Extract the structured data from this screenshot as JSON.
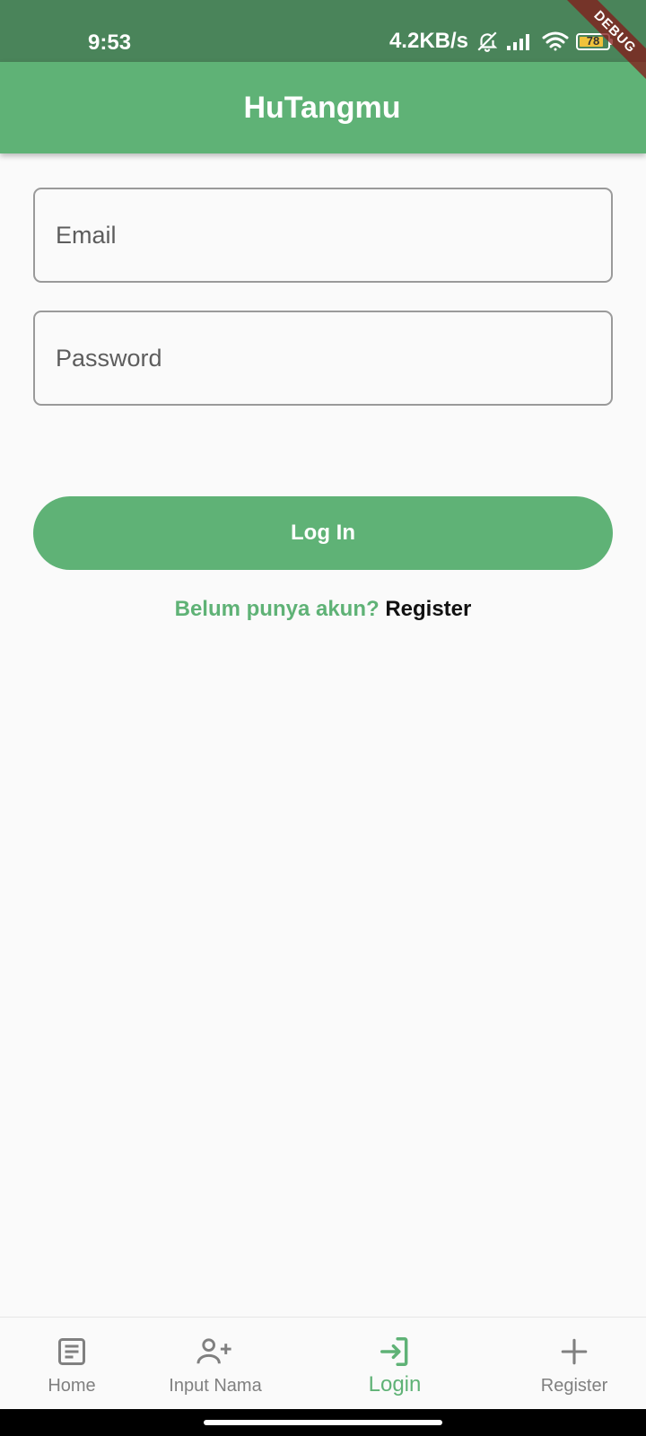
{
  "status_bar": {
    "time": "9:53",
    "network_speed": "4.2KB/s",
    "battery_level": "78",
    "icons": [
      "mute-bell-icon",
      "signal-icon",
      "wifi-icon",
      "battery-icon"
    ]
  },
  "debug_banner": "DEBUG",
  "app_bar": {
    "title": "HuTangmu"
  },
  "form": {
    "email_placeholder": "Email",
    "password_placeholder": "Password",
    "login_label": "Log In",
    "register_prompt": "Belum punya akun?",
    "register_link": "Register"
  },
  "bottom_nav": {
    "active": "Login",
    "items": [
      {
        "label": "Home",
        "icon": "article-icon"
      },
      {
        "label": "Input Nama",
        "icon": "person-add-icon"
      },
      {
        "label": "Login",
        "icon": "login-icon"
      },
      {
        "label": "Register",
        "icon": "add-icon"
      }
    ]
  },
  "colors": {
    "status_bar": "#4a845a",
    "primary": "#5fb276",
    "background": "#fafafa",
    "inactive_nav": "#808080"
  }
}
